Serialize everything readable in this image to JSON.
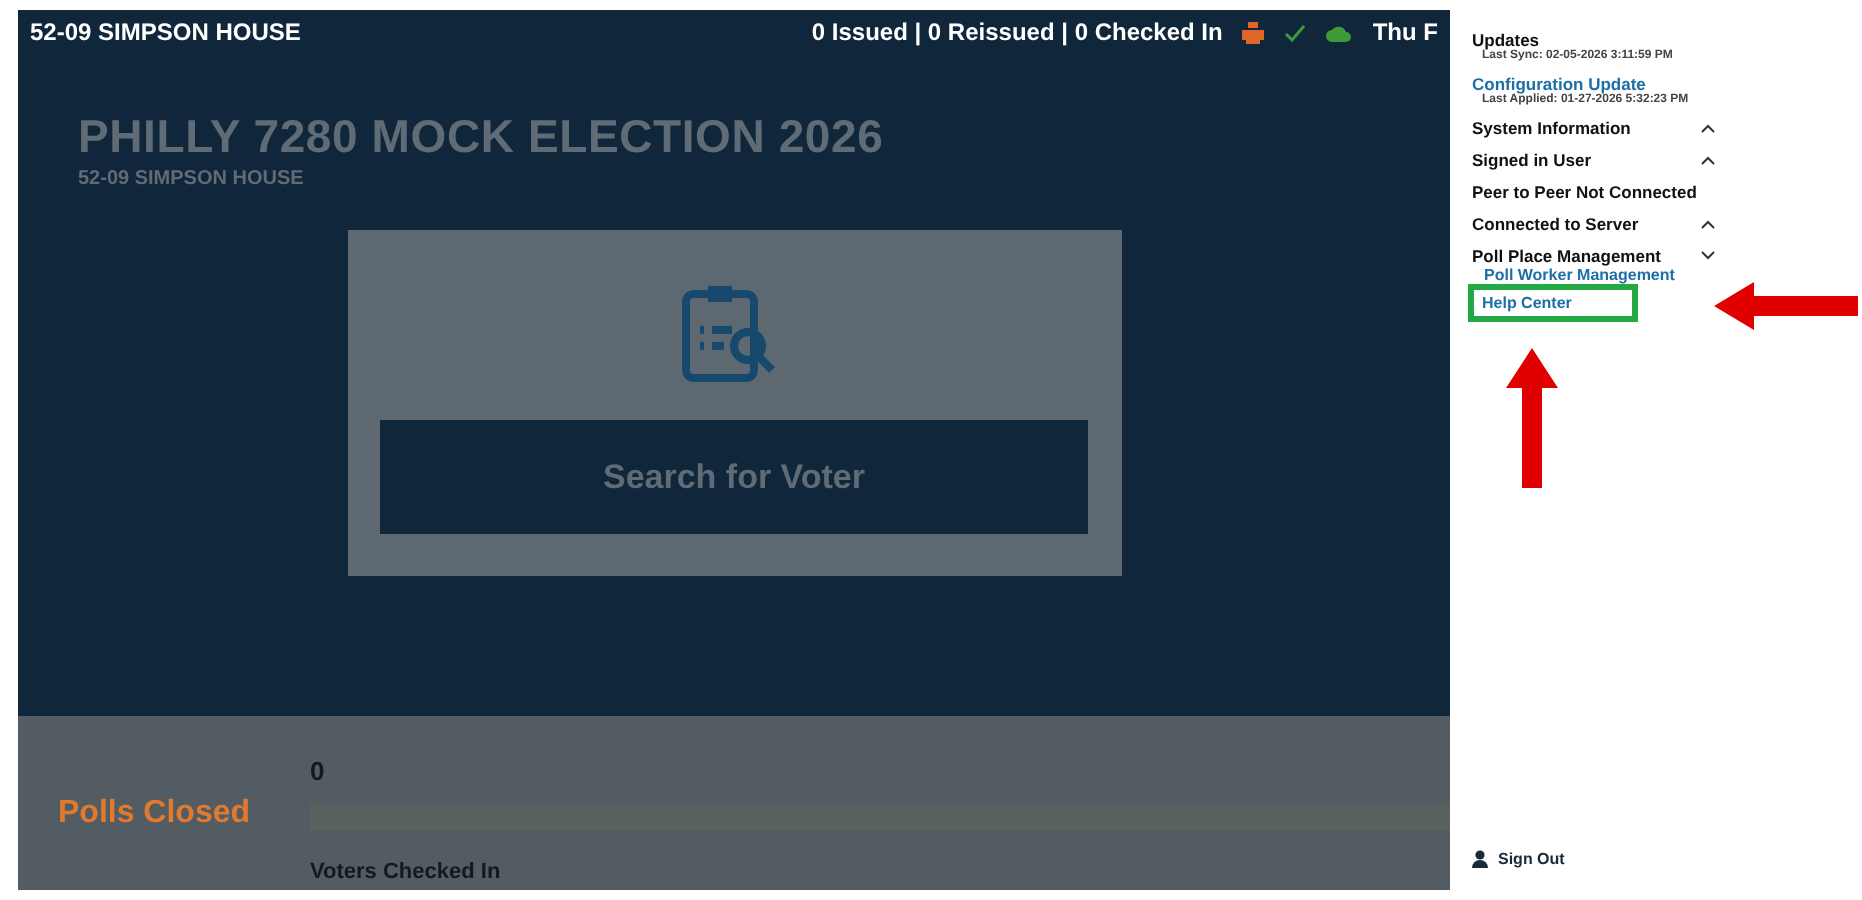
{
  "header": {
    "location": "52-09 SIMPSON HOUSE",
    "counts": "0 Issued | 0 Reissued | 0 Checked In",
    "date": "Thu F"
  },
  "election": {
    "title": "PHILLY 7280 MOCK ELECTION 2026",
    "subtitle": "52-09 SIMPSON HOUSE"
  },
  "search_button": "Search for Voter",
  "footer": {
    "status": "Polls Closed",
    "count": "0",
    "count_label": "Voters Checked In"
  },
  "menu": [
    {
      "kind": "heading",
      "label": "Updates",
      "detail": "Last Sync: 02-05-2026 3:11:59 PM"
    },
    {
      "kind": "link",
      "label": "Configuration Update",
      "detail": "Last Applied: 01-27-2026 5:32:23 PM"
    },
    {
      "kind": "section",
      "label": "System Information",
      "expanded": false
    },
    {
      "kind": "section",
      "label": "Signed in User",
      "expanded": false
    },
    {
      "kind": "heading",
      "label": "Peer to Peer Not Connected"
    },
    {
      "kind": "section",
      "label": "Connected to Server",
      "expanded": false
    },
    {
      "kind": "section",
      "label": "Poll Place Management",
      "expanded": true,
      "children": [
        {
          "label": "Poll Worker Management",
          "highlighted": false
        },
        {
          "label": "Help Center",
          "highlighted": true
        }
      ]
    }
  ],
  "sign_out": "Sign Out"
}
